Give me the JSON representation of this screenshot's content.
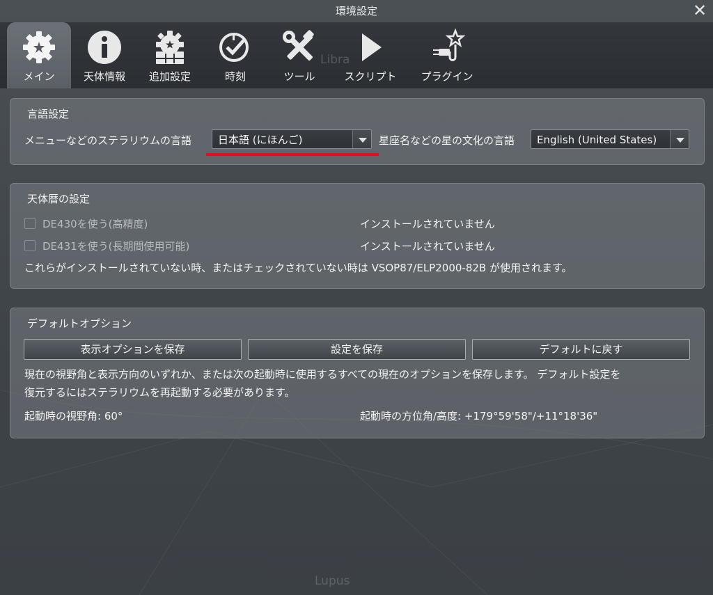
{
  "window": {
    "title": "環境設定",
    "close_icon": "close-icon"
  },
  "tabs": [
    {
      "label": "メイン",
      "icon": "gear-star-icon",
      "active": true
    },
    {
      "label": "天体情報",
      "icon": "info-icon",
      "active": false
    },
    {
      "label": "追加設定",
      "icon": "gear-grid-icon",
      "active": false
    },
    {
      "label": "時刻",
      "icon": "clock-check-icon",
      "active": false
    },
    {
      "label": "ツール",
      "icon": "tools-icon",
      "active": false
    },
    {
      "label": "スクリプト",
      "icon": "play-icon",
      "active": false
    },
    {
      "label": "プラグイン",
      "icon": "plugin-star-icon",
      "active": false
    }
  ],
  "background_labels": {
    "libra": "Libra",
    "lupus": "Lupus"
  },
  "language": {
    "title": "言語設定",
    "app_language_label": "メニューなどのステラリウムの言語",
    "app_language_value": "日本語 (にほんご)",
    "sky_culture_label": "星座名などの星の文化の言語",
    "sky_culture_value": "English (United States)",
    "highlight_color": "#e0101a"
  },
  "ephemeris": {
    "title": "天体暦の設定",
    "de430_label": "DE430を使う(高精度)",
    "de430_status": "インストールされていません",
    "de431_label": "DE431を使う(長期間使用可能)",
    "de431_status": "インストールされていません",
    "note": "これらがインストールされていない時、またはチェックされていない時は VSOP87/ELP2000-82B が使用されます。"
  },
  "defaults": {
    "title": "デフォルトオプション",
    "save_view_button": "表示オプションを保存",
    "save_settings_button": "設定を保存",
    "restore_defaults_button": "デフォルトに戻す",
    "description_line1": "現在の視野角と表示方向のいずれか、または次の起動時に使用するすべての現在のオプションを保存します。 デフォルト設定を",
    "description_line2": "復元するにはステラリウムを再起動する必要があります。",
    "startup_fov": "起動時の視野角: 60°",
    "startup_direction": "起動時の方位角/高度: +179°59'58\"/+11°18'36\""
  }
}
